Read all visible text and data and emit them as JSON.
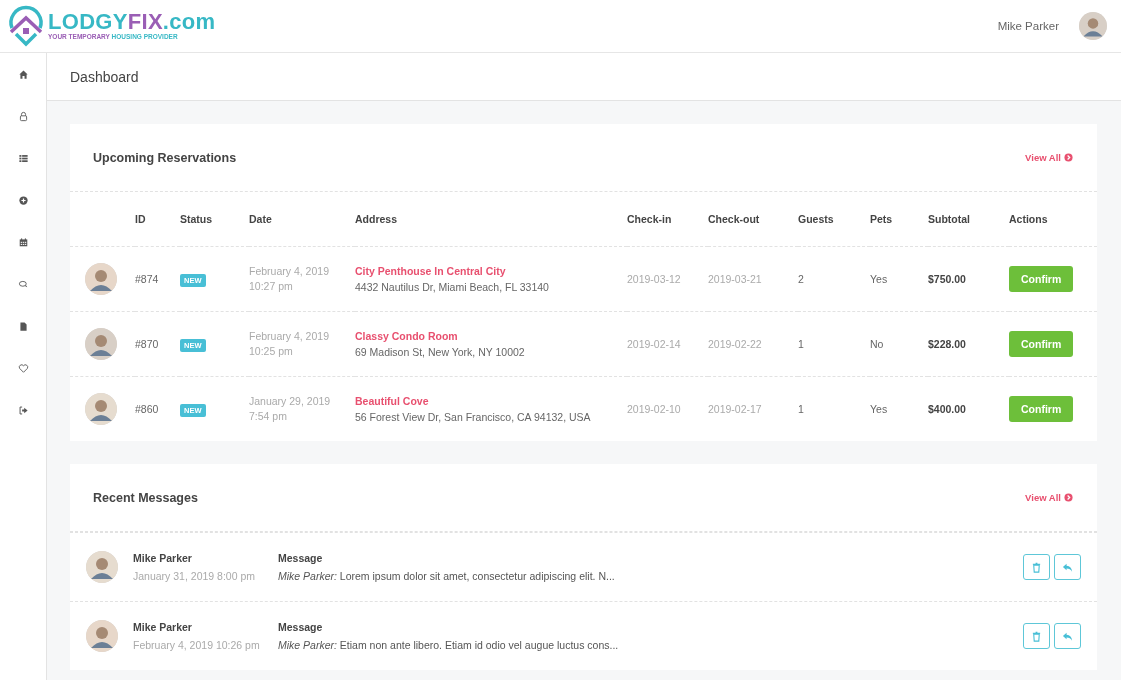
{
  "logo": {
    "name_parts": [
      "LODGY",
      "FIX",
      ".com"
    ],
    "tagline_parts": [
      "YOUR TEMPORARY ",
      "HOUSING PROVIDER"
    ]
  },
  "user": {
    "name": "Mike Parker"
  },
  "sidebar": {
    "items": [
      {
        "kind": "home"
      },
      {
        "kind": "lock"
      },
      {
        "kind": "list"
      },
      {
        "kind": "plus"
      },
      {
        "kind": "calendar"
      },
      {
        "kind": "chat"
      },
      {
        "kind": "file"
      },
      {
        "kind": "heart"
      },
      {
        "kind": "signout"
      }
    ]
  },
  "page_title": "Dashboard",
  "reservations": {
    "title": "Upcoming Reservations",
    "view_all": "View All",
    "columns": [
      "ID",
      "Status",
      "Date",
      "Address",
      "Check-in",
      "Check-out",
      "Guests",
      "Pets",
      "Subtotal",
      "Actions"
    ],
    "rows": [
      {
        "id": "#874",
        "status": "NEW",
        "date": "February 4, 2019",
        "time": "10:27 pm",
        "place": "City Penthouse In Central City",
        "address": "4432 Nautilus Dr, Miami Beach, FL 33140",
        "check_in": "2019-03-12",
        "check_out": "2019-03-21",
        "guests": "2",
        "pets": "Yes",
        "subtotal": "$750.00",
        "action": "Confirm"
      },
      {
        "id": "#870",
        "status": "NEW",
        "date": "February 4, 2019",
        "time": "10:25 pm",
        "place": "Classy Condo Room",
        "address": "69 Madison St, New York, NY 10002",
        "check_in": "2019-02-14",
        "check_out": "2019-02-22",
        "guests": "1",
        "pets": "No",
        "subtotal": "$228.00",
        "action": "Confirm"
      },
      {
        "id": "#860",
        "status": "NEW",
        "date": "January 29, 2019",
        "time": "7:54 pm",
        "place": "Beautiful Cove",
        "address": "56 Forest View Dr, San Francisco, CA 94132, USA",
        "check_in": "2019-02-10",
        "check_out": "2019-02-17",
        "guests": "1",
        "pets": "Yes",
        "subtotal": "$400.00",
        "action": "Confirm"
      }
    ]
  },
  "messages": {
    "title": "Recent Messages",
    "view_all": "View All",
    "items": [
      {
        "sender": "Mike Parker",
        "time": "January 31, 2019 8:00 pm",
        "label": "Message",
        "text": "*Mike Parker:* Lorem ipsum dolor sit amet, consectetur adipiscing elit. N..."
      },
      {
        "sender": "Mike Parker",
        "time": "February 4, 2019 10:26 pm",
        "label": "Message",
        "text": "*Mike Parker:* Etiam non ante libero. Etiam id odio vel augue luctus cons..."
      }
    ]
  }
}
